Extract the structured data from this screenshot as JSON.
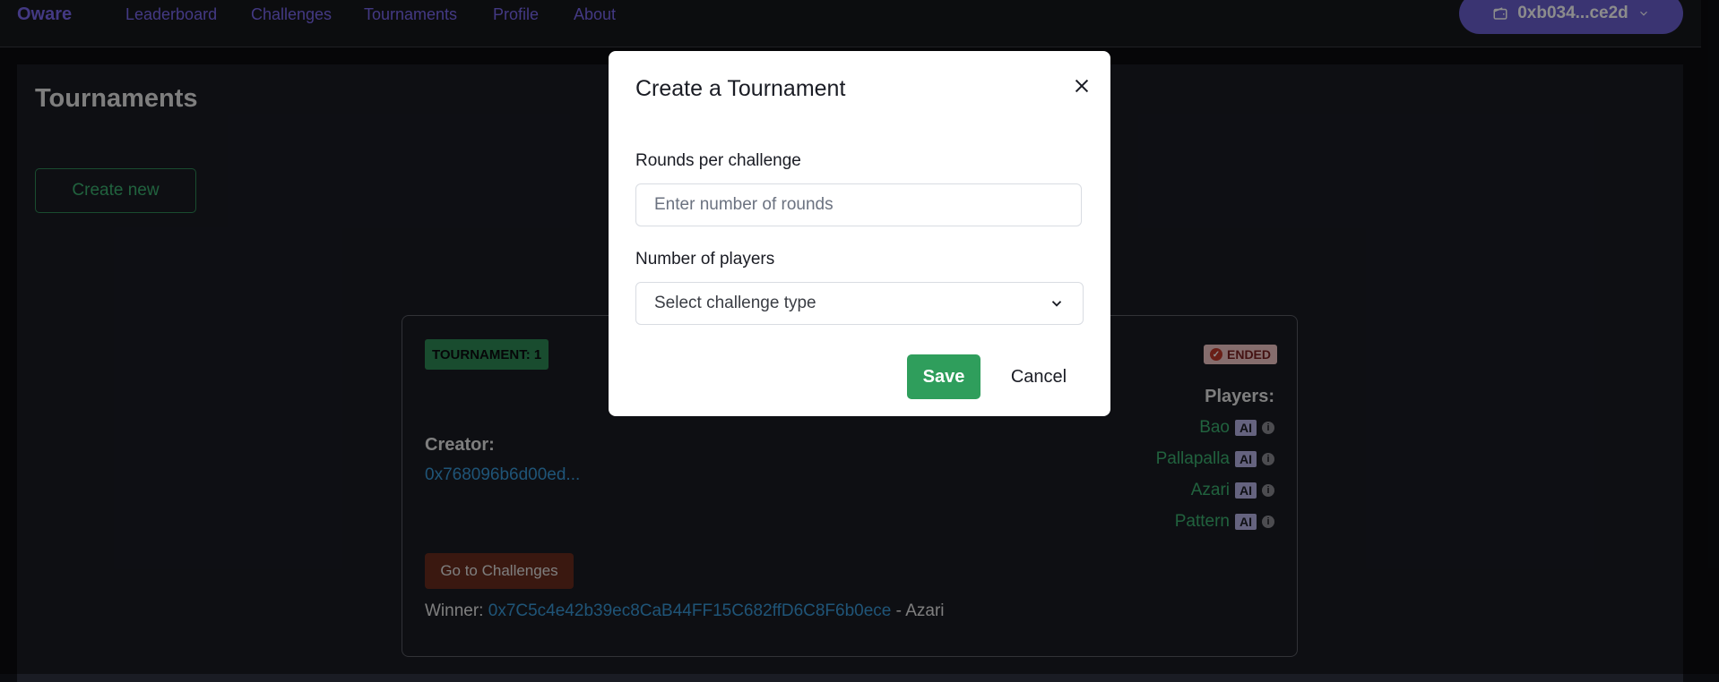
{
  "nav": {
    "brand": "Oware",
    "links": [
      "Leaderboard",
      "Challenges",
      "Tournaments",
      "Profile",
      "About"
    ],
    "wallet": "0xb034...ce2d"
  },
  "page": {
    "title": "Tournaments",
    "create_button": "Create new"
  },
  "tournament": {
    "badge": "TOURNAMENT: 1",
    "status": "ENDED",
    "creator_label": "Creator:",
    "creator_address": "0x768096b6d00ed...",
    "players_label": "Players:",
    "players": [
      {
        "name": "Bao",
        "tag": "AI"
      },
      {
        "name": "Pallapalla",
        "tag": "AI"
      },
      {
        "name": "Azari",
        "tag": "AI"
      },
      {
        "name": "Pattern",
        "tag": "AI"
      }
    ],
    "go_button": "Go to Challenges",
    "winner_label": "Winner:",
    "winner_address": "0x7C5c4e42b39ec8CaB44FF15C682ffD6C8F6b0ece",
    "winner_separator": "-",
    "winner_name": "Azari"
  },
  "modal": {
    "title": "Create a Tournament",
    "rounds_label": "Rounds per challenge",
    "rounds_placeholder": "Enter number of rounds",
    "players_label": "Number of players",
    "players_select_value": "Select challenge type",
    "save_label": "Save",
    "cancel_label": "Cancel"
  },
  "colors": {
    "accent": "#7b68ee",
    "success": "#2f9e5c",
    "link": "#3a9ad9",
    "ended_bg": "#f3c6c6"
  }
}
